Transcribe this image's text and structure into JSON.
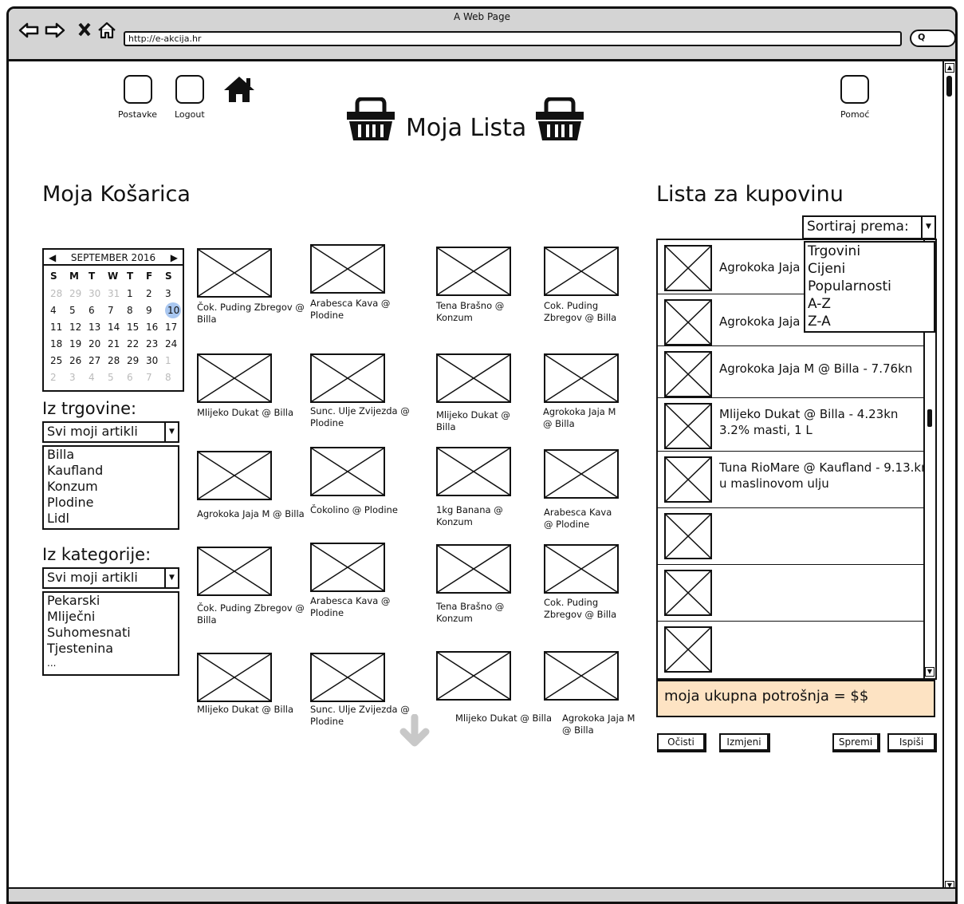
{
  "browser": {
    "window_title": "A Web Page",
    "url": "http://e-akcija.hr",
    "nav_icons": [
      "back-icon",
      "forward-icon",
      "stop-icon",
      "home-outline-icon"
    ]
  },
  "header": {
    "settings_label": "Postavke",
    "logout_label": "Logout",
    "help_label": "Pomoć",
    "title": "Moja Lista"
  },
  "left": {
    "heading": "Moja Košarica",
    "calendar": {
      "month": "SEPTEMBER 2016",
      "days_of_week": [
        "S",
        "M",
        "T",
        "W",
        "T",
        "F",
        "S"
      ],
      "weeks": [
        [
          "28",
          "29",
          "30",
          "31",
          "1",
          "2",
          "3"
        ],
        [
          "4",
          "5",
          "6",
          "7",
          "8",
          "9",
          "10"
        ],
        [
          "11",
          "12",
          "13",
          "14",
          "15",
          "16",
          "17"
        ],
        [
          "18",
          "19",
          "20",
          "21",
          "22",
          "23",
          "24"
        ],
        [
          "25",
          "26",
          "27",
          "28",
          "29",
          "30",
          "1"
        ],
        [
          "2",
          "3",
          "4",
          "5",
          "6",
          "7",
          "8"
        ]
      ],
      "selected": "10"
    },
    "store_filter": {
      "label": "Iz trgovine:",
      "selected": "Svi moji artikli",
      "options": [
        "Billa",
        "Kaufland",
        "Konzum",
        "Plodine",
        "Lidl"
      ]
    },
    "category_filter": {
      "label": "Iz kategorije:",
      "selected": "Svi moji artikli",
      "options": [
        "Pekarski",
        "Mliječni",
        "Suhomesnati",
        "Tjestenina",
        "..."
      ]
    }
  },
  "products": [
    [
      "Čok. Puding Zbregov @ Billa",
      "Arabesca Kava @ Plodine",
      "Tena Brašno @ Konzum",
      "Cok. Puding Zbregov @ Billa"
    ],
    [
      "Mlijeko Dukat @ Billa",
      "Sunc. Ulje Zvijezda @ Plodine",
      "Mlijeko Dukat @ Billa",
      "Agrokoka Jaja M @ Billa"
    ],
    [
      "Agrokoka Jaja M @ Billa",
      "Čokolino @ Plodine",
      "1kg Banana @ Konzum",
      "Arabesca Kava @ Plodine"
    ],
    [
      "Čok. Puding Zbregov @ Billa",
      "Arabesca Kava @ Plodine",
      "Tena Brašno @ Konzum",
      "Cok. Puding Zbregov @ Billa"
    ],
    [
      "Mlijeko Dukat @ Billa",
      "Sunc. Ulje Zvijezda @ Plodine",
      "Mlijeko Dukat @ Billa",
      "Agrokoka Jaja M @ Billa"
    ]
  ],
  "right": {
    "heading": "Lista za kupovinu",
    "sort_label": "Sortiraj prema:",
    "sort_options": [
      "Trgovini",
      "Cijeni",
      "Popularnosti",
      "A-Z",
      "Z-A"
    ],
    "items": [
      {
        "line1": "Agrokoka Jaja",
        "line2": ""
      },
      {
        "line1": "Agrokoka Jaja",
        "line2": ""
      },
      {
        "line1": "Agrokoka Jaja M @ Billa - 7.76kn",
        "line2": ""
      },
      {
        "line1": "Mlijeko Dukat @ Billa - 4.23kn",
        "line2": "3.2% masti, 1 L"
      },
      {
        "line1": "Tuna RioMare @ Kaufland - 9.13.kn",
        "line2": "u maslinovom ulju"
      },
      {
        "line1": "",
        "line2": ""
      },
      {
        "line1": "",
        "line2": ""
      },
      {
        "line1": "",
        "line2": ""
      }
    ],
    "total": "moja ukupna potrošnja = $$",
    "buttons": {
      "clear": "Očisti",
      "edit": "Izmjeni",
      "save": "Spremi",
      "print": "Ispiši"
    }
  }
}
